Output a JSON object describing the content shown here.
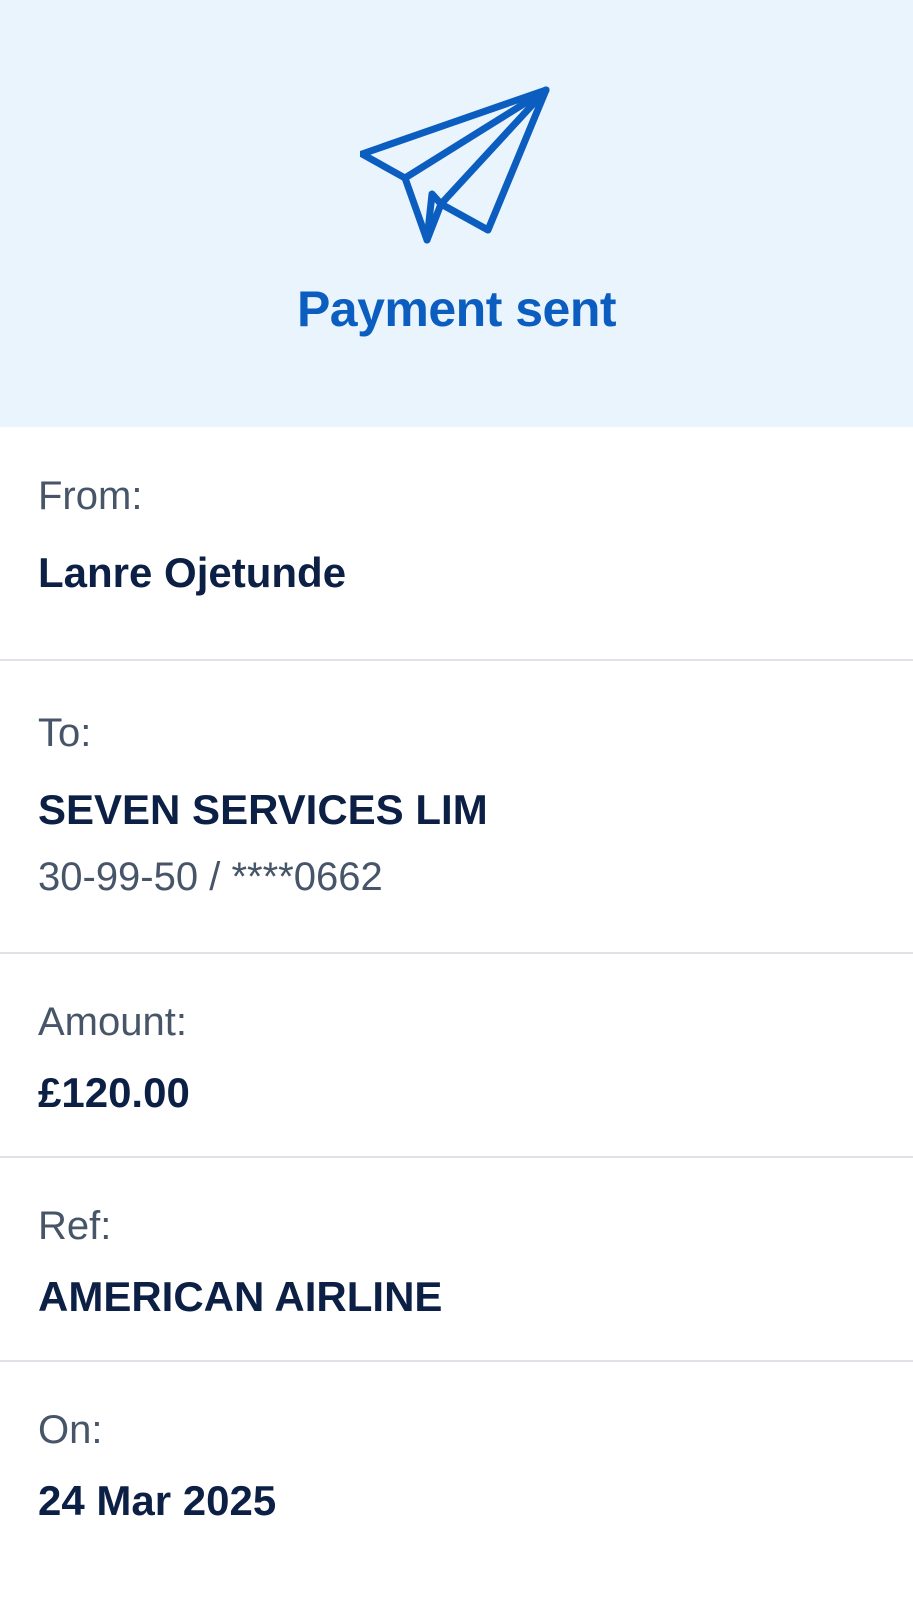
{
  "header": {
    "title": "Payment sent",
    "icon": "paper-plane-icon",
    "background_color": "#eaf4fd",
    "accent_color": "#0b5ebf"
  },
  "details": {
    "from": {
      "label": "From:",
      "value": "Lanre Ojetunde"
    },
    "to": {
      "label": "To:",
      "value": "SEVEN SERVICES LIM",
      "account": "30-99-50 / ****0662"
    },
    "amount": {
      "label": "Amount:",
      "value": "£120.00"
    },
    "ref": {
      "label": "Ref:",
      "value": "AMERICAN AIRLINE"
    },
    "on": {
      "label": "On:",
      "value": "24 Mar 2025"
    }
  }
}
